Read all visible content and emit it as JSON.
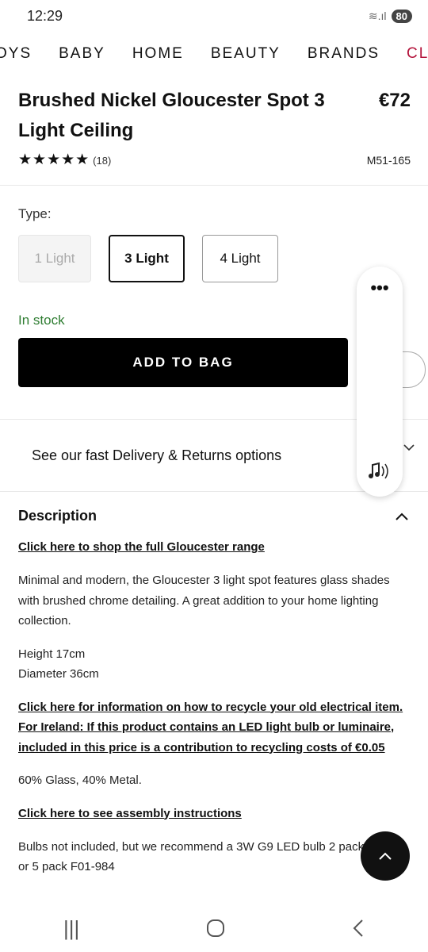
{
  "status_bar": {
    "time": "12:29",
    "signal": "≋.ıl",
    "battery": "80"
  },
  "nav": {
    "items": [
      "OYS",
      "BABY",
      "HOME",
      "BEAUTY",
      "BRANDS",
      "CL"
    ]
  },
  "product": {
    "title": "Brushed Nickel Gloucester Spot 3 Light Ceiling",
    "price": "€72",
    "stars": "★★★★★",
    "rating_value": 5,
    "review_count": "(18)",
    "sku": "M51-165"
  },
  "type_selector": {
    "label": "Type:",
    "options": [
      "1 Light",
      "3 Light",
      "4 Light"
    ],
    "selected": "3 Light"
  },
  "stock_status": "In stock",
  "add_to_bag_label": "ADD TO BAG",
  "delivery_text": "See our fast Delivery & Returns options",
  "description": {
    "heading": "Description",
    "range_link": "Click here to shop the full Gloucester range",
    "body": "Minimal and modern, the Gloucester 3 light spot features glass shades with brushed chrome detailing. A great addition to your home lighting collection.",
    "height": "Height 17cm",
    "diameter": "Diameter 36cm",
    "recycle_link": "Click here for information on how to recycle your old electrical item. For Ireland: If this product contains an LED light bulb or luminaire, included in this price is a contribution to recycling costs of €0.05",
    "material": "60% Glass, 40% Metal.",
    "assembly_link": "Click here to see assembly instructions",
    "bulbs": "Bulbs not included, but we recommend a 3W G9 LED bulb 2 pack F01-83 or 5 pack F01-984"
  },
  "icons": {
    "chevron_up": "^",
    "chevron_down": "v",
    "more": "•••",
    "audio": "♪",
    "scroll_top": "^",
    "recents": "|||",
    "home": "○",
    "back": "<"
  }
}
